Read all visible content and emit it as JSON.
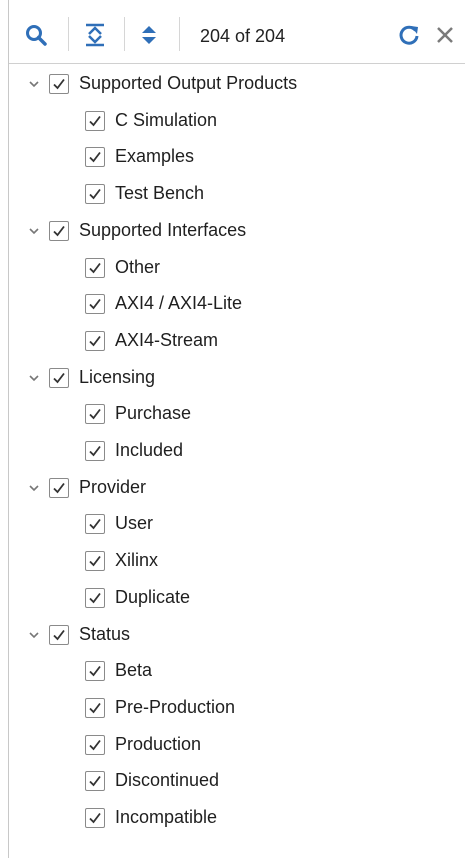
{
  "toolbar": {
    "count_text": "204 of 204",
    "icons": [
      "search-icon",
      "collapse-all-icon",
      "expand-all-icon",
      "refresh-icon",
      "close-icon"
    ]
  },
  "tree": [
    {
      "label": "Supported Output Products",
      "checked": true,
      "expanded": true,
      "children": [
        {
          "label": "C Simulation",
          "checked": true
        },
        {
          "label": "Examples",
          "checked": true
        },
        {
          "label": "Test Bench",
          "checked": true
        }
      ]
    },
    {
      "label": "Supported Interfaces",
      "checked": true,
      "expanded": true,
      "children": [
        {
          "label": "Other",
          "checked": true
        },
        {
          "label": "AXI4 / AXI4-Lite",
          "checked": true
        },
        {
          "label": "AXI4-Stream",
          "checked": true
        }
      ]
    },
    {
      "label": "Licensing",
      "checked": true,
      "expanded": true,
      "children": [
        {
          "label": "Purchase",
          "checked": true
        },
        {
          "label": "Included",
          "checked": true
        }
      ]
    },
    {
      "label": "Provider",
      "checked": true,
      "expanded": true,
      "children": [
        {
          "label": "User",
          "checked": true
        },
        {
          "label": "Xilinx",
          "checked": true
        },
        {
          "label": "Duplicate",
          "checked": true
        }
      ]
    },
    {
      "label": "Status",
      "checked": true,
      "expanded": true,
      "children": [
        {
          "label": "Beta",
          "checked": true
        },
        {
          "label": "Pre-Production",
          "checked": true
        },
        {
          "label": "Production",
          "checked": true
        },
        {
          "label": "Discontinued",
          "checked": true
        },
        {
          "label": "Incompatible",
          "checked": true
        }
      ]
    }
  ]
}
